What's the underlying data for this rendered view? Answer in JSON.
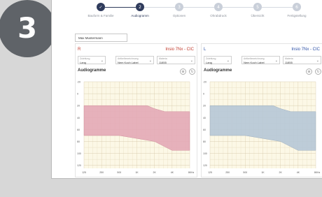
{
  "step_badge": "3",
  "stepper": {
    "steps": [
      {
        "num": "✓",
        "label": "Bauform & Familie",
        "state": "done"
      },
      {
        "num": "2",
        "label": "Audiogramm",
        "state": "active"
      },
      {
        "num": "3",
        "label": "Optionen",
        "state": "todo"
      },
      {
        "num": "4",
        "label": "Ohrabdruck",
        "state": "todo"
      },
      {
        "num": "5",
        "label": "Übersicht",
        "state": "todo"
      },
      {
        "num": "6",
        "label": "Fertigstellung",
        "state": "todo"
      }
    ]
  },
  "name_field": {
    "value": "Max Mustermann"
  },
  "right": {
    "side": "R",
    "device": "Insio 7Nx - CIC",
    "side_color": "#c0392b",
    "select1_label": "Zuleitung",
    "select1_value": "Lang",
    "select2_label": "Artikelbezeichnung",
    "select2_value": "Nem Koch Label",
    "select3_label": "Materia",
    "select3_value": "11855",
    "audiogram_title": "Audiogramme",
    "fill_color": "#e3a9b6",
    "stroke_color": "#c98293"
  },
  "left": {
    "side": "L",
    "device": "Insio 7Nx - CIC",
    "side_color": "#2b4fa6",
    "select1_label": "Zuleitung",
    "select1_value": "Lang",
    "select2_label": "Artikelbezeichnung",
    "select2_value": "Nem Koch Label",
    "select3_label": "Materia",
    "select3_value": "11855",
    "audiogram_title": "Audiogramme",
    "fill_color": "#b6c6d6",
    "stroke_color": "#8fa3b7"
  },
  "chart_data": {
    "type": "area",
    "x_ticks": [
      "125",
      "250",
      "500",
      "1K",
      "2K",
      "4K",
      "8K"
    ],
    "x_unit": "Hz",
    "y_ticks": [
      -20,
      0,
      20,
      40,
      60,
      80,
      100,
      120
    ],
    "ylim": [
      -20,
      125
    ],
    "series": [
      {
        "upper": [
          [
            125,
            20
          ],
          [
            250,
            20
          ],
          [
            500,
            20
          ],
          [
            1000,
            20
          ],
          [
            1500,
            20
          ],
          [
            2000,
            25
          ],
          [
            3000,
            30
          ],
          [
            4000,
            30
          ],
          [
            8000,
            30
          ]
        ],
        "lower": [
          [
            125,
            70
          ],
          [
            250,
            70
          ],
          [
            500,
            70
          ],
          [
            1000,
            75
          ],
          [
            2000,
            80
          ],
          [
            4000,
            95
          ],
          [
            8000,
            95
          ]
        ]
      }
    ]
  }
}
